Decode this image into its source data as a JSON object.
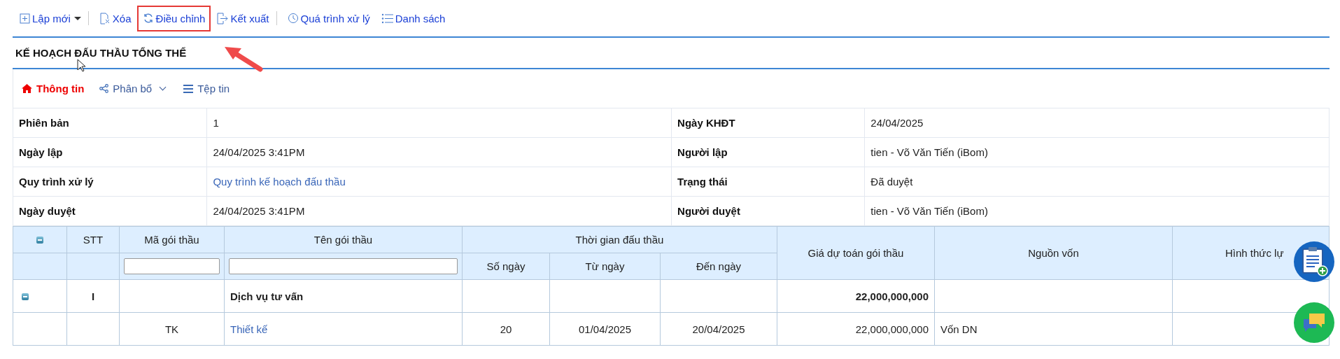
{
  "toolbar": {
    "items": [
      {
        "label": "Lập mới",
        "has_caret": true,
        "separator_before": false,
        "highlighted": false
      },
      {
        "label": "Xóa",
        "has_caret": false,
        "separator_before": true,
        "highlighted": false
      },
      {
        "label": "Điều chỉnh",
        "has_caret": false,
        "separator_before": false,
        "highlighted": true
      },
      {
        "label": "Kết xuất",
        "has_caret": false,
        "separator_before": false,
        "highlighted": false
      },
      {
        "label": "Quá trình xử lý",
        "has_caret": false,
        "separator_before": true,
        "highlighted": false
      },
      {
        "label": "Danh sách",
        "has_caret": false,
        "separator_before": false,
        "highlighted": false
      }
    ]
  },
  "page_title": "KẾ HOẠCH ĐẤU THẦU TỔNG THỂ",
  "tabs": [
    {
      "label": "Thông tin",
      "selected": true,
      "has_caret": false
    },
    {
      "label": "Phân bổ",
      "selected": false,
      "has_caret": true
    },
    {
      "label": "Tệp tin",
      "selected": false,
      "has_caret": false
    }
  ],
  "info_rows": [
    {
      "left": {
        "label": "Phiên bản",
        "value": "1",
        "kind": "text"
      },
      "right": {
        "label": "Ngày KHĐT",
        "value": "24/04/2025",
        "kind": "text"
      }
    },
    {
      "left": {
        "label": "Ngày lập",
        "value": "24/04/2025 3:41PM",
        "kind": "text"
      },
      "right": {
        "label": "Người lập",
        "value": "tien - Võ Văn Tiến (iBom)",
        "kind": "text"
      }
    },
    {
      "left": {
        "label": "Quy trình xử lý",
        "value": "Quy trình kế hoạch đấu thầu",
        "kind": "link"
      },
      "right": {
        "label": "Trạng thái",
        "value": "Đã duyệt",
        "kind": "text"
      }
    },
    {
      "left": {
        "label": "Ngày duyệt",
        "value": "24/04/2025 3:41PM",
        "kind": "text"
      },
      "right": {
        "label": "Người duyệt",
        "value": "tien - Võ Văn Tiến (iBom)",
        "kind": "text"
      }
    }
  ],
  "grid": {
    "columns": {
      "stt": "STT",
      "code": "Mã gói thầu",
      "name": "Tên gói thầu",
      "time_group": "Thời gian đấu thầu",
      "days": "Số ngày",
      "from": "Từ ngày",
      "to": "Đến ngày",
      "amount": "Giá dự toán gói thầu",
      "source": "Nguồn vốn",
      "method": "Hình thức lự"
    },
    "rows": [
      {
        "kind": "group",
        "expanded": true,
        "stt": "I",
        "name": "Dịch vụ tư vấn",
        "amount": "22,000,000,000"
      },
      {
        "kind": "item",
        "code": "TK",
        "name": "Thiết kế",
        "days": "20",
        "from": "01/04/2025",
        "to": "20/04/2025",
        "amount": "22,000,000,000",
        "source": "Vốn DN"
      }
    ]
  }
}
